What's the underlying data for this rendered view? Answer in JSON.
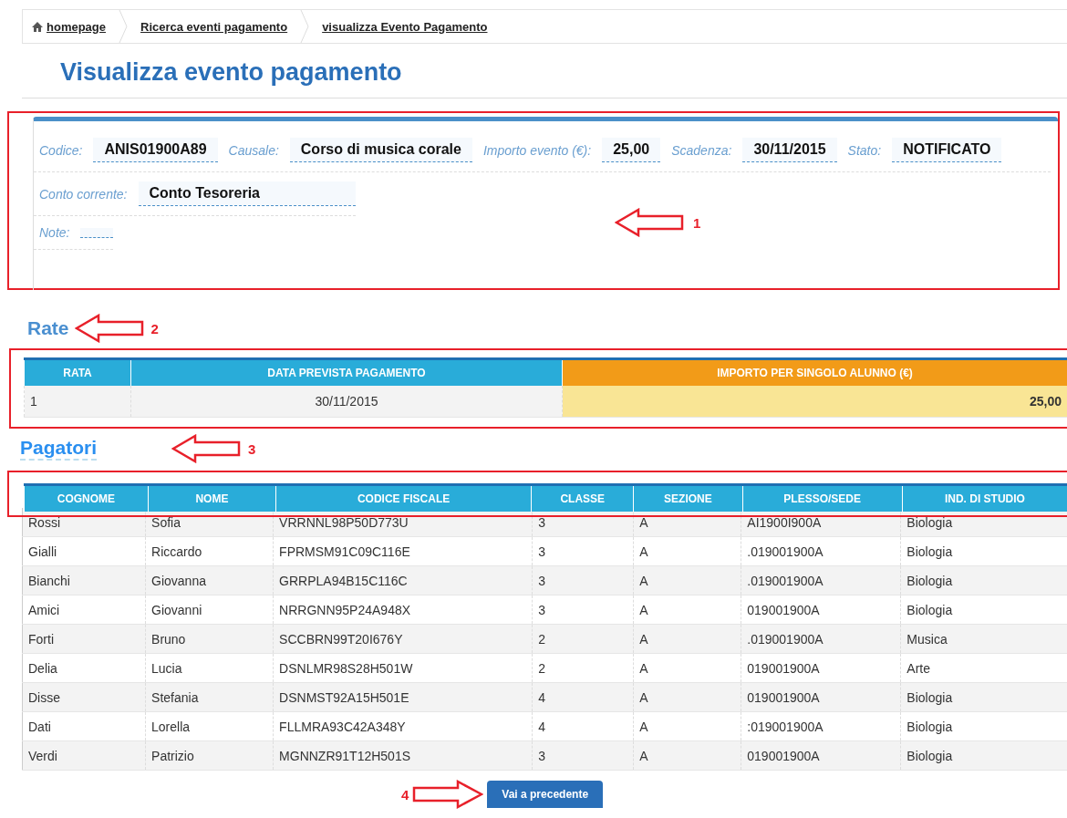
{
  "breadcrumb": [
    {
      "label": "homepage",
      "kind": "home"
    },
    {
      "label": "Ricerca eventi pagamento",
      "kind": "link"
    },
    {
      "label": "visualizza Evento Pagamento",
      "kind": "link"
    }
  ],
  "page_title": "Visualizza evento pagamento",
  "details": {
    "annotation": {
      "number": "1",
      "kind": "leftarrow"
    },
    "rows": [
      [
        {
          "label": "Codice:",
          "value": "ANIS01900A89"
        },
        {
          "label": "Causale:",
          "value": "Corso di musica corale"
        },
        {
          "label": "Importo evento (€):",
          "value": "25,00"
        },
        {
          "label": "Scadenza:",
          "value": "30/11/2015"
        },
        {
          "label": "Stato:",
          "value": "NOTIFICATO"
        }
      ],
      [
        {
          "label": "Conto corrente:",
          "value": "Conto Tesoreria"
        }
      ],
      [
        {
          "label": "Note:"
        }
      ]
    ]
  },
  "rate": {
    "title": "Rate",
    "annotation": {
      "number": "2",
      "kind": "leftarrow"
    },
    "columns": [
      "RATA",
      "DATA PREVISTA PAGAMENTO",
      "IMPORTO PER SINGOLO ALUNNO (€)"
    ],
    "rows": [
      [
        "1",
        "30/11/2015",
        "25,00"
      ]
    ]
  },
  "pagatori": {
    "title": "Pagatori",
    "annotation": {
      "number": "3",
      "kind": "leftarrow"
    },
    "columns": [
      "COGNOME",
      "NOME",
      "CODICE FISCALE",
      "CLASSE",
      "SEZIONE",
      "PLESSO/SEDE",
      "IND. DI STUDIO"
    ],
    "rows": [
      [
        "Rossi",
        "Sofia",
        "VRRNNL98P50D773U",
        "3",
        "A",
        "AI1900I900A",
        "Biologia"
      ],
      [
        "Gialli",
        "Riccardo",
        "FPRMSM91C09C116E",
        "3",
        "A",
        ".019001900A",
        "Biologia"
      ],
      [
        "Bianchi",
        "Giovanna",
        "GRRPLA94B15C116C",
        "3",
        "A",
        ".019001900A",
        "Biologia"
      ],
      [
        "Amici",
        "Giovanni",
        "NRRGNN95P24A948X",
        "3",
        "A",
        "019001900A",
        "Biologia"
      ],
      [
        "Forti",
        "Bruno",
        "SCCBRN99T20I676Y",
        "2",
        "A",
        ".019001900A",
        "Musica"
      ],
      [
        "Delia",
        "Lucia",
        "DSNLMR98S28H501W",
        "2",
        "A",
        "019001900A",
        "Arte"
      ],
      [
        "Disse",
        "Stefania",
        "DSNMST92A15H501E",
        "4",
        "A",
        "019001900A",
        "Biologia"
      ],
      [
        "Dati",
        "Lorella",
        "FLLMRA93C42A348Y",
        "4",
        "A",
        ":019001900A",
        "Biologia"
      ],
      [
        "Verdi",
        "Patrizio",
        "MGNNZR91T12H501S",
        "3",
        "A",
        "019001900A",
        "Biologia"
      ]
    ]
  },
  "back_button": {
    "label": "Vai a precedente",
    "annotation": {
      "number": "4",
      "kind": "rightarrow"
    }
  }
}
